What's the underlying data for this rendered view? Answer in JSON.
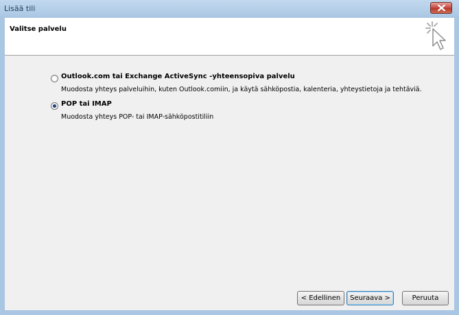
{
  "window": {
    "title": "Lisää tili"
  },
  "header": {
    "title": "Valitse palvelu",
    "icon": "cursor-click-icon"
  },
  "options": [
    {
      "label": "Outlook.com tai Exchange ActiveSync -yhteensopiva palvelu",
      "description": "Muodosta yhteys palveluihin, kuten Outlook.comiin, ja käytä sähköpostia, kalenteria, yhteystietoja ja tehtäviä.",
      "selected": false
    },
    {
      "label": "POP tai IMAP",
      "description": "Muodosta yhteys POP- tai IMAP-sähköpostitiliin",
      "selected": true
    }
  ],
  "buttons": {
    "back": "< Edellinen",
    "next": "Seuraava >",
    "cancel": "Peruuta"
  },
  "colors": {
    "frame": "#a9c6e2",
    "close": "#c75050",
    "client": "#f0f0f0"
  }
}
